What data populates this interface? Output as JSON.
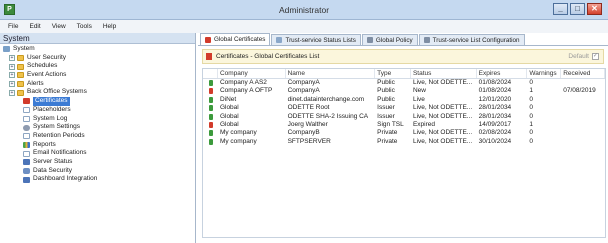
{
  "window": {
    "title": "Administrator",
    "app_icon_glyph": "P"
  },
  "menu": [
    "File",
    "Edit",
    "View",
    "Tools",
    "Help"
  ],
  "sidebar": {
    "title": "System",
    "items": [
      {
        "label": "System",
        "icon": "system-icon",
        "indent": 0,
        "toggle": ""
      },
      {
        "label": "User Security",
        "icon": "folder-icon",
        "indent": 1,
        "toggle": "+"
      },
      {
        "label": "Schedules",
        "icon": "folder-icon",
        "indent": 1,
        "toggle": "+"
      },
      {
        "label": "Event Actions",
        "icon": "folder-icon",
        "indent": 1,
        "toggle": "+"
      },
      {
        "label": "Alerts",
        "icon": "folder-icon",
        "indent": 1,
        "toggle": "+"
      },
      {
        "label": "Back Office Systems",
        "icon": "folder-icon",
        "indent": 1,
        "toggle": "+"
      },
      {
        "label": "Certificates",
        "icon": "certificate-icon",
        "indent": 2,
        "toggle": "",
        "selected": true
      },
      {
        "label": "Placeholders",
        "icon": "placeholder-icon",
        "indent": 2,
        "toggle": ""
      },
      {
        "label": "System Log",
        "icon": "log-icon",
        "indent": 2,
        "toggle": ""
      },
      {
        "label": "System Settings",
        "icon": "settings-icon",
        "indent": 2,
        "toggle": ""
      },
      {
        "label": "Retention Periods",
        "icon": "retention-icon",
        "indent": 2,
        "toggle": ""
      },
      {
        "label": "Reports",
        "icon": "report-icon",
        "indent": 2,
        "toggle": ""
      },
      {
        "label": "Email Notifications",
        "icon": "email-icon",
        "indent": 2,
        "toggle": ""
      },
      {
        "label": "Server Status",
        "icon": "server-icon",
        "indent": 2,
        "toggle": ""
      },
      {
        "label": "Data Security",
        "icon": "security-icon",
        "indent": 2,
        "toggle": ""
      },
      {
        "label": "Dashboard Integration",
        "icon": "dashboard-icon",
        "indent": 2,
        "toggle": ""
      }
    ]
  },
  "tabs": [
    {
      "label": "Global Certificates",
      "active": true,
      "icon": "certificate-icon"
    },
    {
      "label": "Trust-service Status Lists",
      "active": false,
      "icon": "list-icon"
    },
    {
      "label": "Global Policy",
      "active": false,
      "icon": "policy-icon"
    },
    {
      "label": "Trust-service List Configuration",
      "active": false,
      "icon": "config-icon"
    }
  ],
  "panel": {
    "title": "Certificates - Global Certificates List",
    "default_label": "Default",
    "default_checked": true
  },
  "table": {
    "columns": [
      "",
      "Company",
      "Name",
      "Type",
      "Status",
      "Expires",
      "Warnings",
      "Received"
    ],
    "rows": [
      {
        "icon": "green",
        "cells": [
          "Company A AS2",
          "CompanyA",
          "Public",
          "Live, Not ODETTE...",
          "01/08/2024",
          "0",
          ""
        ]
      },
      {
        "icon": "red",
        "cells": [
          "Company A OFTP",
          "CompanyA",
          "Public",
          "New",
          "01/08/2024",
          "1",
          "07/08/2019"
        ]
      },
      {
        "icon": "green",
        "cells": [
          "DiNet",
          "dinet.datainterchange.com",
          "Public",
          "Live",
          "12/01/2020",
          "0",
          ""
        ]
      },
      {
        "icon": "green",
        "cells": [
          "Global",
          "ODETTE Root",
          "Issuer",
          "Live, Not ODETTE...",
          "28/01/2034",
          "0",
          ""
        ]
      },
      {
        "icon": "green",
        "cells": [
          "Global",
          "ODETTE SHA-2 Issuing CA",
          "Issuer",
          "Live, Not ODETTE...",
          "28/01/2034",
          "0",
          ""
        ]
      },
      {
        "icon": "red",
        "cells": [
          "Global",
          "Joerg Walther",
          "Sign TSL",
          "Expired",
          "14/09/2017",
          "1",
          ""
        ]
      },
      {
        "icon": "green",
        "cells": [
          "My company",
          "CompanyB",
          "Private",
          "Live, Not ODETTE...",
          "02/08/2024",
          "0",
          ""
        ]
      },
      {
        "icon": "green",
        "cells": [
          "My company",
          "SFTPSERVER",
          "Private",
          "Live, Not ODETTE...",
          "30/10/2024",
          "0",
          ""
        ]
      }
    ]
  },
  "colors": {
    "accent": "#3b7bd4",
    "status_ok": "#3c9a3c",
    "status_error": "#d23b2b"
  }
}
